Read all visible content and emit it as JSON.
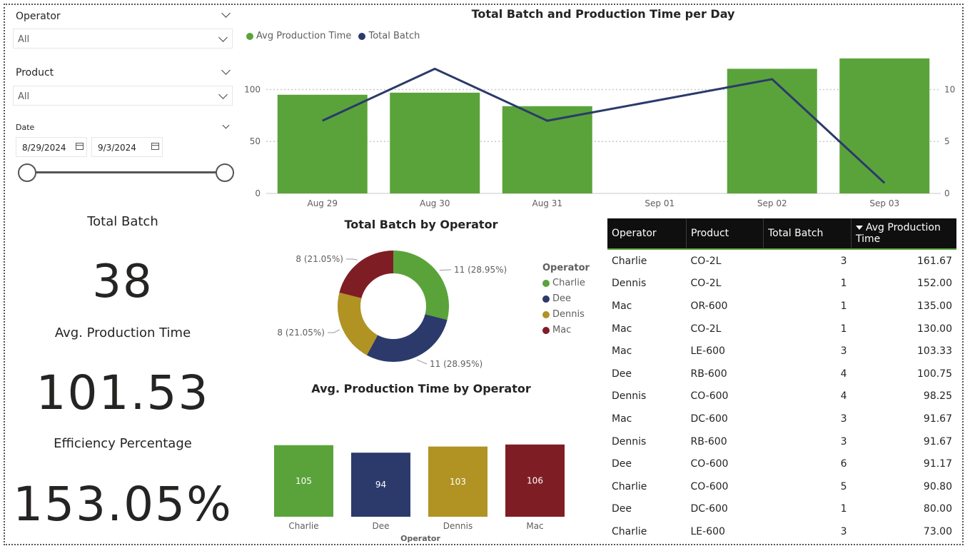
{
  "slicers": {
    "operator": {
      "title": "Operator",
      "value": "All"
    },
    "product": {
      "title": "Product",
      "value": "All"
    },
    "date": {
      "title": "Date",
      "start": "8/29/2024",
      "end": "9/3/2024"
    }
  },
  "kpis": {
    "total_batch_label": "Total Batch",
    "total_batch_value": "38",
    "avg_prod_label": "Avg. Production Time",
    "avg_prod_value": "101.53",
    "efficiency_label": "Efficiency Percentage",
    "efficiency_value": "153.05%"
  },
  "colors": {
    "green": "#5aa33a",
    "navy": "#2b3a6b",
    "gold": "#b09323",
    "maroon": "#7f1d25"
  },
  "chart_data": [
    {
      "type": "bar",
      "title": "Total Batch and Production Time per Day",
      "categories": [
        "Aug 29",
        "Aug 30",
        "Aug 31",
        "Sep 01",
        "Sep 02",
        "Sep 03"
      ],
      "series": [
        {
          "name": "Avg Production Time",
          "kind": "bar",
          "axis": "left",
          "values": [
            95,
            97,
            84,
            null,
            120,
            130
          ]
        },
        {
          "name": "Total Batch",
          "kind": "line",
          "axis": "right",
          "values": [
            7,
            12,
            7,
            null,
            11,
            1
          ]
        }
      ],
      "left_ticks": [
        "0",
        "50",
        "100"
      ],
      "right_ticks": [
        "0",
        "5",
        "10"
      ],
      "ylim_left": [
        0,
        145
      ],
      "ylim_right": [
        0,
        14.5
      ],
      "legend": "top-left"
    },
    {
      "type": "pie",
      "title": "Total Batch by Operator",
      "legend_title": "Operator",
      "slices": [
        {
          "name": "Charlie",
          "value": 11,
          "label": "11 (28.95%)"
        },
        {
          "name": "Dee",
          "value": 11,
          "label": "11 (28.95%)"
        },
        {
          "name": "Dennis",
          "value": 8,
          "label": "8 (21.05%)"
        },
        {
          "name": "Mac",
          "value": 8,
          "label": "8 (21.05%)"
        }
      ]
    },
    {
      "type": "bar",
      "title": "Avg. Production Time by Operator",
      "xlabel": "Operator",
      "categories": [
        "Charlie",
        "Dee",
        "Dennis",
        "Mac"
      ],
      "values": [
        105,
        94,
        103,
        106
      ],
      "data_labels": [
        "105",
        "94",
        "103",
        "106"
      ]
    }
  ],
  "table": {
    "headers": [
      "Operator",
      "Product",
      "Total Batch",
      "Avg Production Time"
    ],
    "rows": [
      [
        "Charlie",
        "CO-2L",
        "3",
        "161.67"
      ],
      [
        "Dennis",
        "CO-2L",
        "1",
        "152.00"
      ],
      [
        "Mac",
        "OR-600",
        "1",
        "135.00"
      ],
      [
        "Mac",
        "CO-2L",
        "1",
        "130.00"
      ],
      [
        "Mac",
        "LE-600",
        "3",
        "103.33"
      ],
      [
        "Dee",
        "RB-600",
        "4",
        "100.75"
      ],
      [
        "Dennis",
        "CO-600",
        "4",
        "98.25"
      ],
      [
        "Mac",
        "DC-600",
        "3",
        "91.67"
      ],
      [
        "Dennis",
        "RB-600",
        "3",
        "91.67"
      ],
      [
        "Dee",
        "CO-600",
        "6",
        "91.17"
      ],
      [
        "Charlie",
        "CO-600",
        "5",
        "90.80"
      ],
      [
        "Dee",
        "DC-600",
        "1",
        "80.00"
      ],
      [
        "Charlie",
        "LE-600",
        "3",
        "73.00"
      ]
    ]
  }
}
